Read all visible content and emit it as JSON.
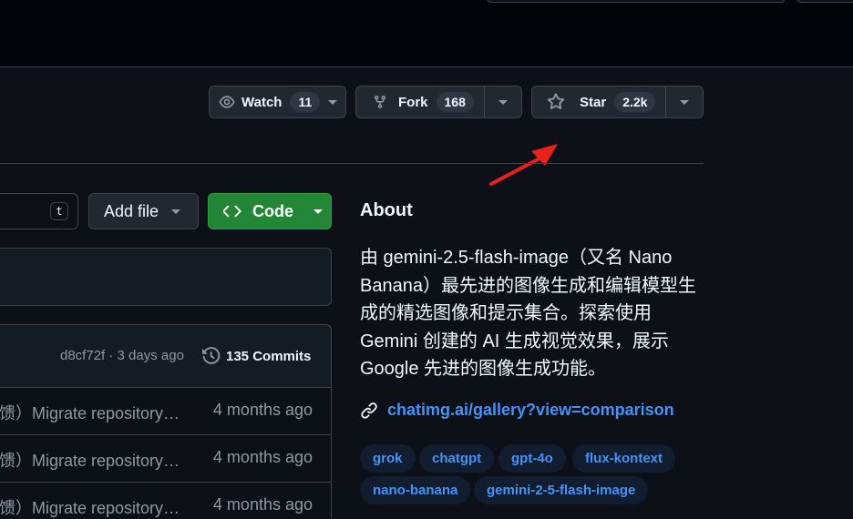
{
  "actions": {
    "watch": {
      "label": "Watch",
      "count": "11"
    },
    "fork": {
      "label": "Fork",
      "count": "168"
    },
    "star": {
      "label": "Star",
      "count": "2.2k"
    }
  },
  "file_toolbar": {
    "search_hotkey": "t",
    "add_file_label": "Add file",
    "code_label": "Code"
  },
  "latest_commit": {
    "sha_and_time": "d8cf72f · 3 days ago",
    "commits_count": "135 Commits"
  },
  "file_rows": [
    {
      "message": "馈）Migrate repository…",
      "age": "4 months ago"
    },
    {
      "message": "馈）Migrate repository…",
      "age": "4 months ago"
    },
    {
      "message": "馈）Migrate repository…",
      "age": "4 months ago"
    }
  ],
  "about": {
    "title": "About",
    "description_lines": [
      "由 gemini-2.5-flash-image（又名 Nano",
      "Banana）最先进的图像生成和编辑模型生",
      "成的精选图像和提示集合。探索使用",
      "Gemini 创建的 AI 生成视觉效果，展示",
      "Google 先进的图像生成功能。"
    ],
    "link": "chatimg.ai/gallery?view=comparison",
    "topics": [
      "grok",
      "chatgpt",
      "gpt-4o",
      "flux-kontext",
      "nano-banana",
      "gemini-2-5-flash-image"
    ]
  },
  "colors": {
    "background": "#0d1117",
    "topbar": "#010409",
    "border": "#3d444d",
    "button": "#212830",
    "code_green": "#238636",
    "link_blue": "#4493f8",
    "topic_bg": "#121d2f",
    "annotation_arrow": "#e8221b"
  },
  "icons": [
    "eye-icon",
    "repo-forked-icon",
    "star-icon",
    "code-icon",
    "history-icon",
    "link-icon",
    "triangle-down-icon"
  ]
}
